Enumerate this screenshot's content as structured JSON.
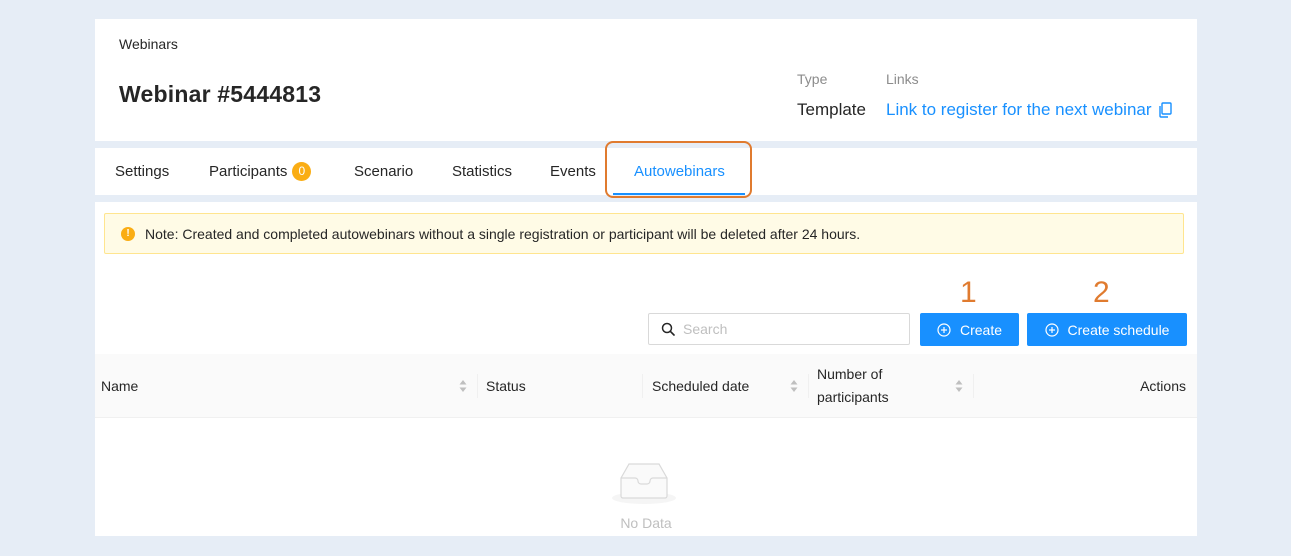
{
  "header": {
    "breadcrumb": "Webinars",
    "title": "Webinar #5444813",
    "type_label": "Type",
    "type_value": "Template",
    "links_label": "Links",
    "link_text": "Link to register for the next webinar",
    "link_icon": "copy-icon"
  },
  "tabs": [
    {
      "label": "Settings",
      "active": false
    },
    {
      "label": "Participants",
      "active": false,
      "badge": "0"
    },
    {
      "label": "Scenario",
      "active": false
    },
    {
      "label": "Statistics",
      "active": false
    },
    {
      "label": "Events",
      "active": false
    },
    {
      "label": "Autowebinars",
      "active": true
    }
  ],
  "alert": {
    "icon": "exclamation-circle-icon",
    "text": "Note: Created and completed autowebinars without a single registration or participant will be deleted after 24 hours."
  },
  "annotations": {
    "step1": "1",
    "step2": "2"
  },
  "toolbar": {
    "search_placeholder": "Search",
    "search_value": "",
    "create_label": "Create",
    "create_schedule_label": "Create schedule"
  },
  "table": {
    "columns": {
      "name": "Name",
      "status": "Status",
      "scheduled_date": "Scheduled date",
      "participants_line1": "Number of",
      "participants_line2": "participants",
      "actions": "Actions"
    },
    "rows": [],
    "empty_text": "No Data"
  },
  "colors": {
    "accent": "#1890ff",
    "annotation": "#e07b2f",
    "warning": "#faad14",
    "alert_bg": "#fffbe6",
    "page_bg": "#e6edf6"
  }
}
